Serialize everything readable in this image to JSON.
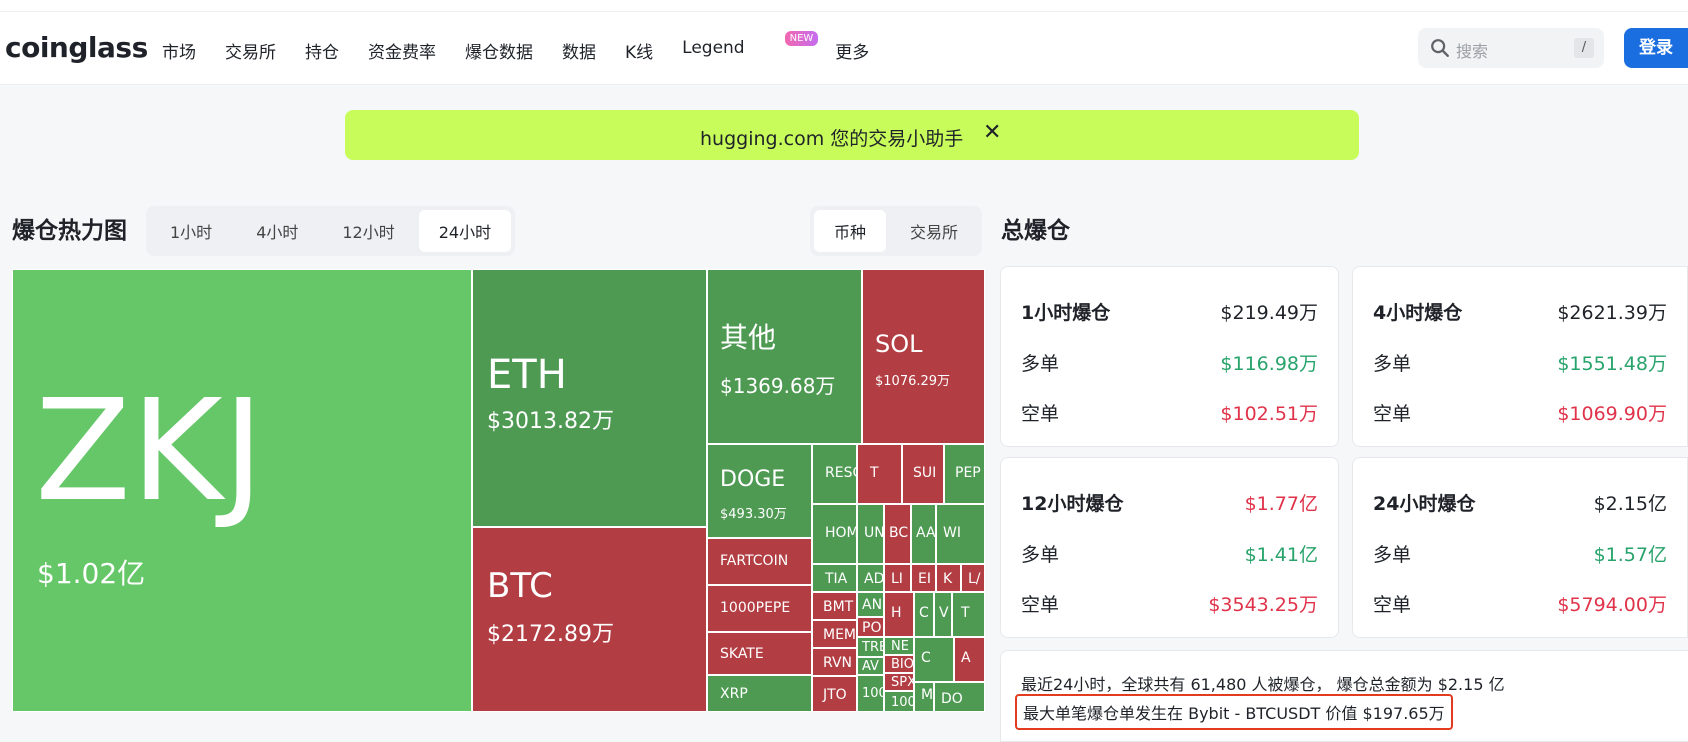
{
  "header": {
    "logo": "coinglass",
    "nav": [
      "市场",
      "交易所",
      "持仓",
      "资金费率",
      "爆仓数据",
      "数据",
      "K线",
      "Legend",
      "更多"
    ],
    "legend_badge": "NEW",
    "search_placeholder": "搜索",
    "search_shortcut": "/",
    "login_label": "登录"
  },
  "banner": {
    "text": "hugging.com 您的交易小助手",
    "close": "✕"
  },
  "heatmap": {
    "title": "爆仓热力图",
    "time_tabs": [
      "1小时",
      "4小时",
      "12小时",
      "24小时"
    ],
    "active_time_tab": "24小时",
    "group_tabs": [
      "币种",
      "交易所"
    ],
    "active_group_tab": "币种"
  },
  "treemap": {
    "colors": {
      "long": "#66c769",
      "long_dark": "#4e9a53",
      "short": "#b23d43",
      "short_light": "#c24e52"
    },
    "cells": [
      {
        "sym": "ZKJ",
        "val": "$1.02亿",
        "side": "long"
      },
      {
        "sym": "ETH",
        "val": "$3013.82万",
        "side": "long_dark"
      },
      {
        "sym": "BTC",
        "val": "$2172.89万",
        "side": "short"
      },
      {
        "sym": "其他",
        "val": "$1369.68万",
        "side": "long_dark"
      },
      {
        "sym": "SOL",
        "val": "$1076.29万",
        "side": "short"
      },
      {
        "sym": "DOGE",
        "val": "$493.30万",
        "side": "long_dark"
      },
      {
        "sym": "FARTCOIN",
        "val": "",
        "side": "short"
      },
      {
        "sym": "1000PEPE",
        "val": "",
        "side": "short"
      },
      {
        "sym": "SKATE",
        "val": "",
        "side": "short"
      },
      {
        "sym": "XRP",
        "val": "",
        "side": "long_dark"
      },
      {
        "sym": "RESO",
        "val": "",
        "side": "long_dark"
      },
      {
        "sym": "T",
        "val": "",
        "side": "short"
      },
      {
        "sym": "SUI",
        "val": "",
        "side": "short"
      },
      {
        "sym": "PEP",
        "val": "",
        "side": "long_dark"
      },
      {
        "sym": "HOM",
        "val": "",
        "side": "long_dark"
      },
      {
        "sym": "UN",
        "val": "",
        "side": "long_dark"
      },
      {
        "sym": "BC",
        "val": "",
        "side": "short"
      },
      {
        "sym": "AA",
        "val": "",
        "side": "long_dark"
      },
      {
        "sym": "WI",
        "val": "",
        "side": "long_dark"
      },
      {
        "sym": "TIA",
        "val": "",
        "side": "long_dark"
      },
      {
        "sym": "AD",
        "val": "",
        "side": "long_dark"
      },
      {
        "sym": "LI",
        "val": "",
        "side": "short"
      },
      {
        "sym": "EI",
        "val": "",
        "side": "short"
      },
      {
        "sym": "K",
        "val": "",
        "side": "short"
      },
      {
        "sym": "L/",
        "val": "",
        "side": "short"
      },
      {
        "sym": "BMT",
        "val": "",
        "side": "short"
      },
      {
        "sym": "AN",
        "val": "",
        "side": "long_dark"
      },
      {
        "sym": "MEM",
        "val": "",
        "side": "short"
      },
      {
        "sym": "PO",
        "val": "",
        "side": "short"
      },
      {
        "sym": "RVN",
        "val": "",
        "side": "short"
      },
      {
        "sym": "TRE",
        "val": "",
        "side": "long_dark"
      },
      {
        "sym": "JTO",
        "val": "",
        "side": "short"
      },
      {
        "sym": "AV",
        "val": "",
        "side": "long_dark"
      },
      {
        "sym": "100",
        "val": "",
        "side": "long_dark"
      },
      {
        "sym": "NE",
        "val": "",
        "side": "long_dark"
      },
      {
        "sym": "BIO",
        "val": "",
        "side": "short"
      },
      {
        "sym": "SPX",
        "val": "",
        "side": "short"
      },
      {
        "sym": "100",
        "val": "",
        "side": "long_dark"
      },
      {
        "sym": "H",
        "val": "",
        "side": "short"
      },
      {
        "sym": "C",
        "val": "",
        "side": "long_dark"
      },
      {
        "sym": "V",
        "val": "",
        "side": "long_dark"
      },
      {
        "sym": "T",
        "val": "",
        "side": "long_dark"
      },
      {
        "sym": "C",
        "val": "",
        "side": "long_dark"
      },
      {
        "sym": "M",
        "val": "",
        "side": "long_dark"
      },
      {
        "sym": "A",
        "val": "",
        "side": "short"
      },
      {
        "sym": "DO",
        "val": "",
        "side": "long_dark"
      }
    ]
  },
  "totals": {
    "title": "总爆仓",
    "cards": [
      {
        "label": "1小时爆仓",
        "total": "$219.49万",
        "total_color": "dark",
        "long_label": "多单",
        "long": "$116.98万",
        "short_label": "空单",
        "short": "$102.51万"
      },
      {
        "label": "4小时爆仓",
        "total": "$2621.39万",
        "total_color": "dark",
        "long_label": "多单",
        "long": "$1551.48万",
        "short_label": "空单",
        "short": "$1069.90万"
      },
      {
        "label": "12小时爆仓",
        "total": "$1.77亿",
        "total_color": "red",
        "long_label": "多单",
        "long": "$1.41亿",
        "short_label": "空单",
        "short": "$3543.25万"
      },
      {
        "label": "24小时爆仓",
        "total": "$2.15亿",
        "total_color": "dark",
        "long_label": "多单",
        "long": "$1.57亿",
        "short_label": "空单",
        "short": "$5794.00万"
      }
    ],
    "summary_line1": "最近24小时，全球共有 61,480 人被爆仓， 爆仓总金额为 $2.15 亿",
    "summary_line2": "最大单笔爆仓单发生在 Bybit - BTCUSDT 价值 $197.65万"
  }
}
